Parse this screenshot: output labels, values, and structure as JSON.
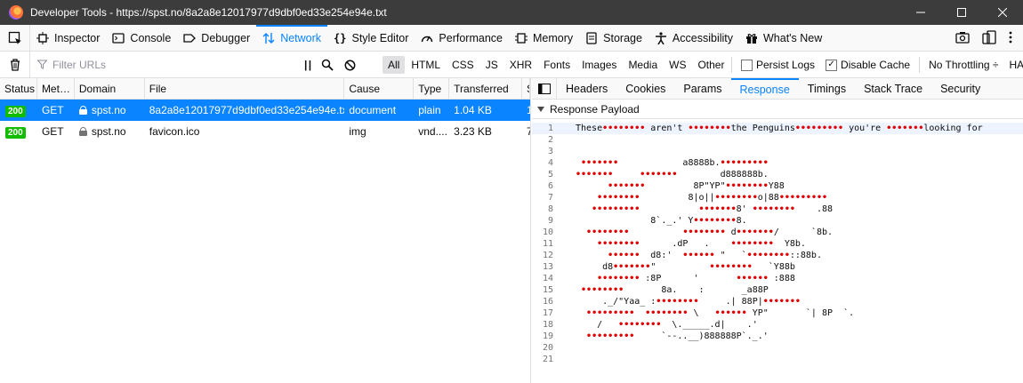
{
  "window": {
    "title": "Developer Tools - https://spst.no/8a2a8e12017977d9dbf0ed33e254e94e.txt"
  },
  "toolbar": {
    "tabs": [
      "Inspector",
      "Console",
      "Debugger",
      "Network",
      "Style Editor",
      "Performance",
      "Memory",
      "Storage",
      "Accessibility",
      "What's New"
    ],
    "active_tab": "Network"
  },
  "filterbar": {
    "placeholder": "Filter URLs",
    "pause_label": "| |",
    "types": [
      "All",
      "HTML",
      "CSS",
      "JS",
      "XHR",
      "Fonts",
      "Images",
      "Media",
      "WS",
      "Other"
    ],
    "active_type": "All",
    "persist_logs": "Persist Logs",
    "persist_logs_checked": false,
    "disable_cache": "Disable Cache",
    "disable_cache_checked": true,
    "throttling": "No Throttling ÷",
    "har": "HAR ÷"
  },
  "requests": {
    "headers": [
      "Status",
      "Met…",
      "Domain",
      "File",
      "Cause",
      "Type",
      "Transferred",
      "S"
    ],
    "rows": [
      {
        "status": "200",
        "method": "GET",
        "domain": "spst.no",
        "file": "8a2a8e12017977d9dbf0ed33e254e94e.txt",
        "cause": "document",
        "type": "plain",
        "transferred": "1.04 KB",
        "size": "1"
      },
      {
        "status": "200",
        "method": "GET",
        "domain": "spst.no",
        "file": "favicon.ico",
        "cause": "img",
        "type": "vnd....",
        "transferred": "3.23 KB",
        "size": "7"
      }
    ]
  },
  "details": {
    "tabs": [
      "Headers",
      "Cookies",
      "Params",
      "Response",
      "Timings",
      "Stack Trace",
      "Security"
    ],
    "active_tab": "Response",
    "payload_title": "Response Payload",
    "lines": [
      "These•••••••• aren't ••••••••the Penguins••••••••• you're •••••••looking for",
      "",
      "",
      " •••••••            a8888b.•••••••••",
      "•••••••     •••••••        d888888b.",
      "      •••••••         8P\"YP\"••••••••Y88",
      "    ••••••••         8|o||••••••••o|88•••••••••",
      "   •••••••••           •••••••8' ••••••••    .88",
      "              8`._.' Y••••••••8.",
      "  ••••••••          •••••••• d•••••••/      `8b.",
      "    ••••••••      .dP   .    ••••••••  Y8b.",
      "      ••••••  d8:'  •••••• \"   `••••••••::88b.",
      "     d8•••••••\"          ••••••••   `Y88b",
      "    •••••••• :8P      '       •••••• :888",
      " ••••••••       8a.    :       _a88P",
      "     ._/\"Yaa_ :••••••••     .| 88P|•••••••",
      "  •••••••••  •••••••• \\   •••••• YP\"       `| 8P  `.",
      "    /   ••••••••  \\._____.d|    .'",
      "  •••••••••     `--..__)888888P`._.'",
      "",
      ""
    ]
  }
}
